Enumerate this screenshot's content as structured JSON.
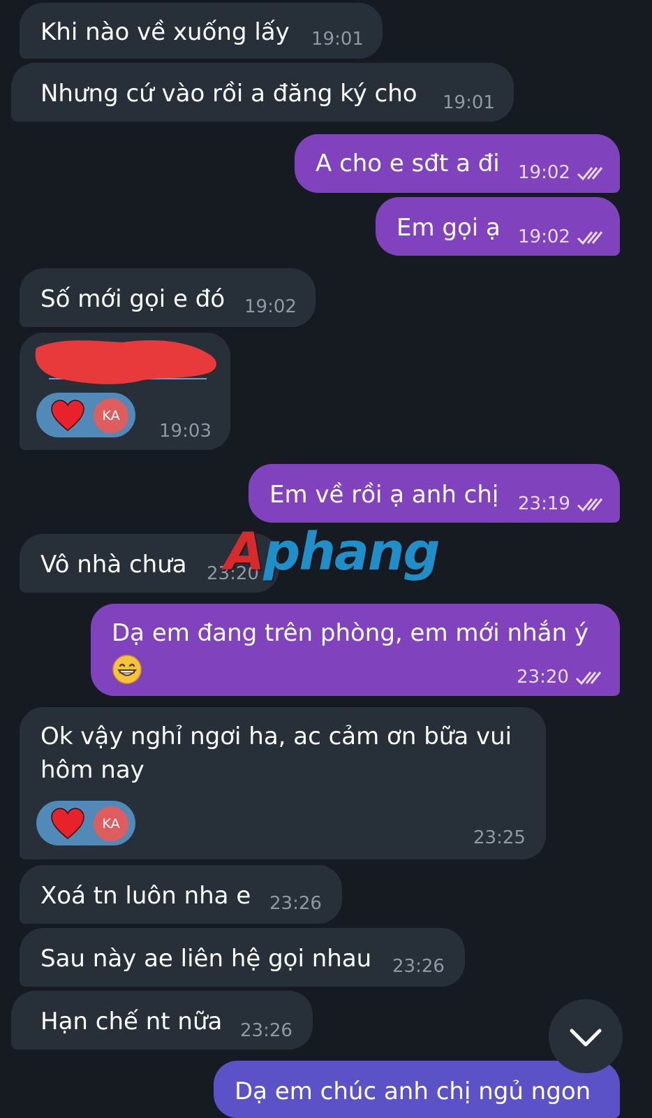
{
  "messages": [
    {
      "type": "incoming",
      "text": "Khi nào về xuống lấy",
      "time": "19:01"
    },
    {
      "type": "incoming",
      "text": "Nhưng cứ vào rồi a đăng ký cho",
      "time": "19:01"
    },
    {
      "type": "outgoing",
      "text": "A cho e sđt a đi",
      "time": "19:02"
    },
    {
      "type": "outgoing",
      "text": "Em gọi ạ",
      "time": "19:02"
    },
    {
      "type": "incoming",
      "text": "Số mới gọi e đó",
      "time": "19:02"
    },
    {
      "type": "incoming",
      "text": "",
      "time": "19:03",
      "reaction": {
        "icon": "heart-icon",
        "avatar": "KA"
      }
    },
    {
      "type": "outgoing",
      "text": "Em về rồi ạ anh chị",
      "time": "23:19"
    },
    {
      "type": "incoming",
      "text": "Vô nhà chưa",
      "time": "23:20"
    },
    {
      "type": "outgoing",
      "text": "Dạ em đang trên phòng, em mới nhắn ý",
      "time": "23:20",
      "emoji": "grinning-face-icon"
    },
    {
      "type": "incoming",
      "text_line1": "Ok vậy nghỉ ngơi ha, ac cảm ơn bữa vui",
      "text_line2": "hôm nay",
      "time": "23:25",
      "reaction": {
        "icon": "heart-icon",
        "avatar": "KA"
      }
    },
    {
      "type": "incoming",
      "text": "Xoá tn luôn nha e",
      "time": "23:26"
    },
    {
      "type": "incoming",
      "text": "Sau này ae liên hệ gọi nhau",
      "time": "23:26"
    },
    {
      "type": "incoming",
      "text": "Hạn chế nt nữa",
      "time": "23:26"
    },
    {
      "type": "outgoing",
      "text": "Dạ em chúc anh chị ngủ ngon",
      "time": ""
    }
  ],
  "watermark": {
    "first": "A",
    "rest": "phang"
  },
  "colors": {
    "background": "#161b22",
    "incoming_bubble": "#273039",
    "outgoing_bubble": "#8042bd",
    "reaction_pill": "#4f8ab8",
    "avatar": "#e05d5d"
  },
  "icons": {
    "read_receipt": "double-check-icon",
    "scroll_down": "chevron-down-icon"
  }
}
